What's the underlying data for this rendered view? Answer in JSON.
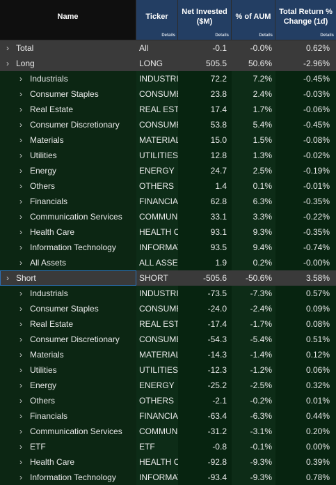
{
  "columns": {
    "name": "Name",
    "ticker": "Ticker",
    "invested": "Net Invested ($M)",
    "aum": "% of AUM",
    "ret": "Total Return % Change (1d)",
    "details_label": "Details"
  },
  "rows": [
    {
      "kind": "group",
      "name": "Total",
      "ticker": "All",
      "inv": "-0.1",
      "aum": "-0.0%",
      "ret": "0.62%"
    },
    {
      "kind": "group",
      "name": "Long",
      "ticker": "LONG",
      "inv": "505.5",
      "aum": "50.6%",
      "ret": "-2.96%"
    },
    {
      "kind": "child",
      "name": "Industrials",
      "ticker": "INDUSTRIALS",
      "inv": "72.2",
      "aum": "7.2%",
      "ret": "-0.45%"
    },
    {
      "kind": "child",
      "name": "Consumer Staples",
      "ticker": "CONSUMER STAPLES",
      "inv": "23.8",
      "aum": "2.4%",
      "ret": "-0.03%"
    },
    {
      "kind": "child",
      "name": "Real Estate",
      "ticker": "REAL ESTATE",
      "inv": "17.4",
      "aum": "1.7%",
      "ret": "-0.06%"
    },
    {
      "kind": "child",
      "name": "Consumer Discretionary",
      "ticker": "CONSUMER DISCRETIONARY",
      "inv": "53.8",
      "aum": "5.4%",
      "ret": "-0.45%"
    },
    {
      "kind": "child",
      "name": "Materials",
      "ticker": "MATERIALS",
      "inv": "15.0",
      "aum": "1.5%",
      "ret": "-0.08%"
    },
    {
      "kind": "child",
      "name": "Utilities",
      "ticker": "UTILITIES",
      "inv": "12.8",
      "aum": "1.3%",
      "ret": "-0.02%"
    },
    {
      "kind": "child",
      "name": "Energy",
      "ticker": "ENERGY",
      "inv": "24.7",
      "aum": "2.5%",
      "ret": "-0.19%"
    },
    {
      "kind": "child",
      "name": "Others",
      "ticker": "OTHERS",
      "inv": "1.4",
      "aum": "0.1%",
      "ret": "-0.01%"
    },
    {
      "kind": "child",
      "name": "Financials",
      "ticker": "FINANCIALS",
      "inv": "62.8",
      "aum": "6.3%",
      "ret": "-0.35%"
    },
    {
      "kind": "child",
      "name": "Communication Services",
      "ticker": "COMMUNICATION SERVICES",
      "inv": "33.1",
      "aum": "3.3%",
      "ret": "-0.22%"
    },
    {
      "kind": "child",
      "name": "Health Care",
      "ticker": "HEALTH CARE",
      "inv": "93.1",
      "aum": "9.3%",
      "ret": "-0.35%"
    },
    {
      "kind": "child",
      "name": "Information Technology",
      "ticker": "INFORMATION TECHNOLOGY",
      "inv": "93.5",
      "aum": "9.4%",
      "ret": "-0.74%"
    },
    {
      "kind": "child",
      "name": "All Assets",
      "ticker": "ALL ASSETS",
      "inv": "1.9",
      "aum": "0.2%",
      "ret": "-0.00%"
    },
    {
      "kind": "group",
      "name": "Short",
      "ticker": "SHORT",
      "inv": "-505.6",
      "aum": "-50.6%",
      "ret": "3.58%",
      "selected": true
    },
    {
      "kind": "child",
      "name": "Industrials",
      "ticker": "INDUSTRIALS",
      "inv": "-73.5",
      "aum": "-7.3%",
      "ret": "0.57%"
    },
    {
      "kind": "child",
      "name": "Consumer Staples",
      "ticker": "CONSUMER STAPLES",
      "inv": "-24.0",
      "aum": "-2.4%",
      "ret": "0.09%"
    },
    {
      "kind": "child",
      "name": "Real Estate",
      "ticker": "REAL ESTATE",
      "inv": "-17.4",
      "aum": "-1.7%",
      "ret": "0.08%"
    },
    {
      "kind": "child",
      "name": "Consumer Discretionary",
      "ticker": "CONSUMER DISCRETIONARY",
      "inv": "-54.3",
      "aum": "-5.4%",
      "ret": "0.51%"
    },
    {
      "kind": "child",
      "name": "Materials",
      "ticker": "MATERIALS",
      "inv": "-14.3",
      "aum": "-1.4%",
      "ret": "0.12%"
    },
    {
      "kind": "child",
      "name": "Utilities",
      "ticker": "UTILITIES",
      "inv": "-12.3",
      "aum": "-1.2%",
      "ret": "0.06%"
    },
    {
      "kind": "child",
      "name": "Energy",
      "ticker": "ENERGY",
      "inv": "-25.2",
      "aum": "-2.5%",
      "ret": "0.32%"
    },
    {
      "kind": "child",
      "name": "Others",
      "ticker": "OTHERS",
      "inv": "-2.1",
      "aum": "-0.2%",
      "ret": "0.01%"
    },
    {
      "kind": "child",
      "name": "Financials",
      "ticker": "FINANCIALS",
      "inv": "-63.4",
      "aum": "-6.3%",
      "ret": "0.44%"
    },
    {
      "kind": "child",
      "name": "Communication Services",
      "ticker": "COMMUNICATION SERVICES",
      "inv": "-31.2",
      "aum": "-3.1%",
      "ret": "0.20%"
    },
    {
      "kind": "child",
      "name": "ETF",
      "ticker": "ETF",
      "inv": "-0.8",
      "aum": "-0.1%",
      "ret": "0.00%"
    },
    {
      "kind": "child",
      "name": "Health Care",
      "ticker": "HEALTH CARE",
      "inv": "-92.8",
      "aum": "-9.3%",
      "ret": "0.39%"
    },
    {
      "kind": "child",
      "name": "Information Technology",
      "ticker": "INFORMATION TECHNOLOGY",
      "inv": "-93.4",
      "aum": "-9.3%",
      "ret": "0.78%"
    }
  ],
  "icons": {
    "expand": "chevron-right-icon",
    "glyph": "›"
  },
  "colors": {
    "header_selected": "#233e63",
    "group_row": "#3a3a3a",
    "child_row": "#0c2613",
    "selection": "#2d6fb3"
  }
}
